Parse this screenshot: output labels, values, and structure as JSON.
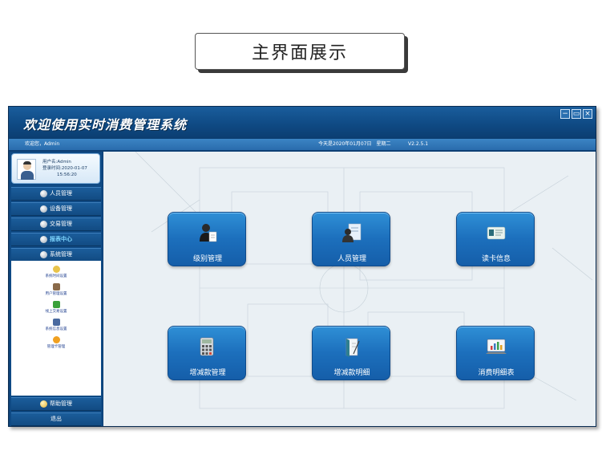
{
  "caption": "主界面展示",
  "app": {
    "title": "欢迎使用实时消费管理系统",
    "window_buttons": [
      "−",
      "▭",
      "×"
    ]
  },
  "statusbar": {
    "welcome": "欢迎您，Admin",
    "date": "今天是2020年01月07日　星期二",
    "version": "V2.2.5.1"
  },
  "user": {
    "name_line": "用户名:Admin",
    "login_time_label": "登录时间:2020-01-07",
    "login_time": "15:56:20"
  },
  "nav": [
    {
      "label": "人员管理",
      "icon": "person-icon"
    },
    {
      "label": "设备管理",
      "icon": "device-icon"
    },
    {
      "label": "交易管理",
      "icon": "transaction-icon"
    },
    {
      "label": "报表中心",
      "icon": "report-icon"
    },
    {
      "label": "系统管理",
      "icon": "system-icon"
    }
  ],
  "submenu": [
    {
      "label": "系统时间设置",
      "icon": "clock-icon",
      "color": "#e8c34a"
    },
    {
      "label": "用户管理设置",
      "icon": "user-icon",
      "color": "#8a6a4a"
    },
    {
      "label": "线上交易设置",
      "icon": "online-trade-icon",
      "color": "#3aa03a"
    },
    {
      "label": "系统信息设置",
      "icon": "system-info-icon",
      "color": "#4a6aa0"
    },
    {
      "label": "管理卡管理",
      "icon": "card-icon",
      "color": "#f0a020"
    }
  ],
  "bottom_nav": [
    {
      "label": "帮助管理",
      "icon": "help-icon"
    },
    {
      "label": "退出",
      "icon": ""
    }
  ],
  "tiles": [
    {
      "label": "级别管理",
      "icon": "level-icon"
    },
    {
      "label": "人员管理",
      "icon": "people-icon"
    },
    {
      "label": "读卡信息",
      "icon": "card-reader-icon"
    },
    {
      "label": "增减款管理",
      "icon": "calculator-icon"
    },
    {
      "label": "增减款明细",
      "icon": "detail-book-icon"
    },
    {
      "label": "消费明细表",
      "icon": "chart-monitor-icon"
    }
  ],
  "colors": {
    "titlebar": "#0f4a84",
    "statusbar": "#2a6cad",
    "tile": "#1c6fbc",
    "active_nav": "#7fd7ff"
  }
}
